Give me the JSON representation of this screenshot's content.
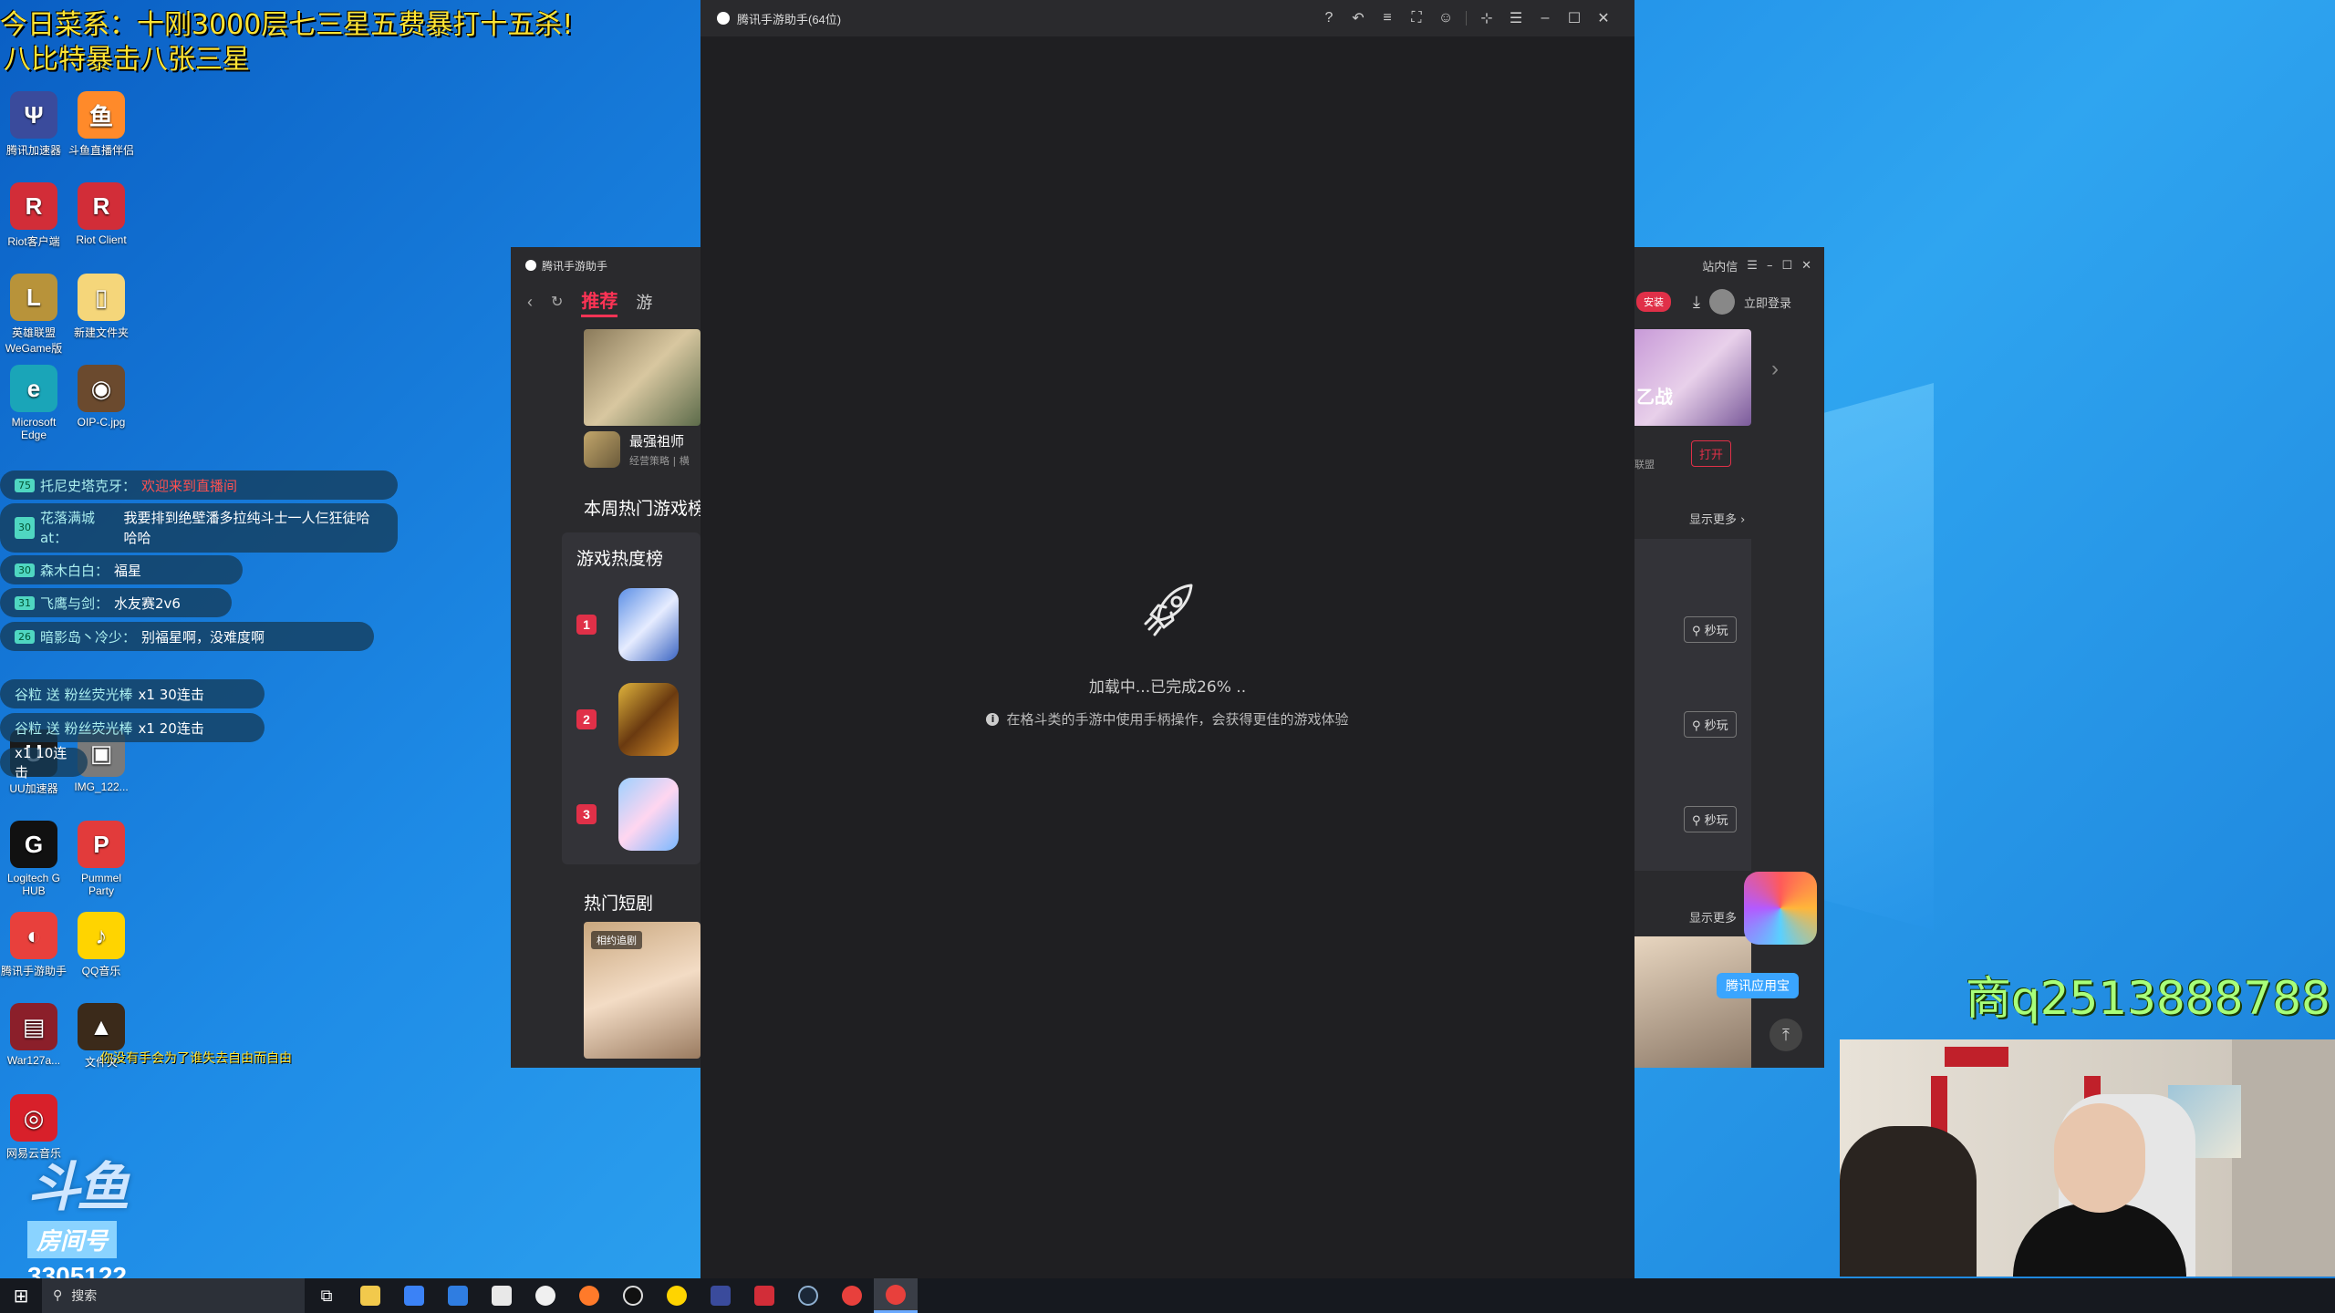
{
  "overlay": {
    "line1": "今日菜系：十刚3000层七三星五费暴打十五杀!",
    "line2": "八比特暴击八张三星"
  },
  "desktop_icons": [
    {
      "label": "腾讯加速器",
      "color": "#3a4b9c",
      "glyph": "Ψ"
    },
    {
      "label": "斗鱼直播伴侣",
      "color": "#ff8a2a",
      "glyph": "鱼"
    },
    {
      "label": "Riot客户端",
      "color": "#d22d38",
      "glyph": "R"
    },
    {
      "label": "Riot Client",
      "color": "#d22d38",
      "glyph": "R"
    },
    {
      "label": "英雄联盟WeGame版",
      "color": "#b8933a",
      "glyph": "L"
    },
    {
      "label": "新建文件夹",
      "color": "#f5d67a",
      "glyph": "▯"
    },
    {
      "label": "Microsoft Edge",
      "color": "#1aa5b8",
      "glyph": "e"
    },
    {
      "label": "OIP-C.jpg",
      "color": "#6b4a2e",
      "glyph": "◉"
    },
    {
      "label": "UU加速器",
      "color": "#1a1a1a",
      "glyph": "U"
    },
    {
      "label": "IMG_122...",
      "color": "#7a7a7a",
      "glyph": "▣"
    },
    {
      "label": "Logitech G HUB",
      "color": "#111111",
      "glyph": "G"
    },
    {
      "label": "Pummel Party",
      "color": "#e23b3b",
      "glyph": "P"
    },
    {
      "label": "腾讯手游助手",
      "color": "#e8403c",
      "glyph": "◐"
    },
    {
      "label": "QQ音乐",
      "color": "#ffd400",
      "glyph": "♪"
    },
    {
      "label": "War127a...",
      "color": "#8b1f2a",
      "glyph": "▤"
    },
    {
      "label": "文件夹",
      "color": "#3b2a1a",
      "glyph": "▲"
    },
    {
      "label": "网易云音乐",
      "color": "#d8202a",
      "glyph": "◎"
    }
  ],
  "danmaku": [
    {
      "badge": "75",
      "name": "托尼史塔克牙：",
      "text": "欢迎来到直播间",
      "red": true
    },
    {
      "badge": "30",
      "name": "花落满城at：",
      "text": "我要排到绝壁潘多拉纯斗士一人仨狂徒哈哈哈",
      "red": false
    },
    {
      "badge": "30",
      "name": "森木白白：",
      "text": "福星",
      "red": false
    },
    {
      "badge": "31",
      "name": "飞鹰与剑：",
      "text": "水友赛2v6",
      "red": false
    },
    {
      "badge": "26",
      "name": "暗影岛丶冷少：",
      "text": "别福星啊，没难度啊",
      "red": false
    },
    {
      "badge": "",
      "name": "谷粒 送 粉丝荧光棒",
      "text": "x1 30连击",
      "red": false
    },
    {
      "badge": "",
      "name": "谷粒 送 粉丝荧光棒",
      "text": "x1 20连击",
      "red": false
    },
    {
      "badge": "",
      "name": "",
      "text": "x1 10连击",
      "red": false
    }
  ],
  "scroller_text": "你没有手会为了谁失去自由而自由",
  "main_window": {
    "title": "腾讯手游助手(64位)",
    "loading_text": "加载中...已完成26% ..",
    "tip_text": "在格斗类的手游中使用手柄操作，会获得更佳的游戏体验",
    "progress_percent": 26
  },
  "bg_app": {
    "brand": "腾讯手游助手",
    "nav_active": "推荐",
    "nav_next": "游",
    "game_title": "最强祖师",
    "game_tags": "经营策略 | 横",
    "section_hot": "本周热门游戏榜",
    "ranking_title": "游戏热度榜",
    "ranks": [
      "1",
      "2",
      "3"
    ],
    "section_short": "热门短剧",
    "drama_tag": "相约追剧",
    "right_menu": "站内信",
    "login": "立即登录",
    "install_tag": "安装",
    "open_btn": "打开",
    "right_label": "乙战",
    "right_sub": "联盟",
    "show_more": "显示更多",
    "play_btn": "秒玩",
    "store_badge": "腾讯应用宝"
  },
  "watermark": {
    "platform": "斗鱼",
    "room_label": "房间号",
    "room_number": "3305122"
  },
  "promo": "商q2513888788",
  "taskbar": {
    "search_placeholder": "搜索"
  }
}
